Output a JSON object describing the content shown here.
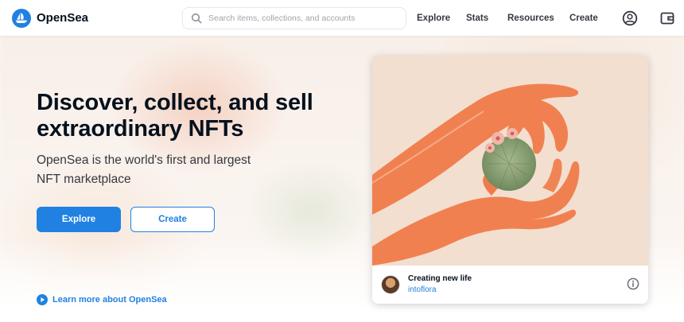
{
  "header": {
    "logo_text": "OpenSea",
    "search_placeholder": "Search items, collections, and accounts",
    "nav": [
      "Explore",
      "Stats",
      "Resources",
      "Create"
    ],
    "icons": [
      "account-icon",
      "wallet-icon"
    ]
  },
  "hero": {
    "title": "Discover, collect, and sell extraordinary NFTs",
    "subtitle": "OpenSea is the world's first and largest NFT marketplace",
    "explore_label": "Explore",
    "create_label": "Create",
    "learn_more": "Learn more about OpenSea"
  },
  "featured": {
    "title": "Creating new life",
    "creator": "intoflora",
    "artwork": "hands-holding-cactus-illustration"
  },
  "colors": {
    "brand": "#2081e2",
    "text": "#04111d",
    "art_background": "#f3dfcf",
    "hand": "#f07a4a"
  }
}
